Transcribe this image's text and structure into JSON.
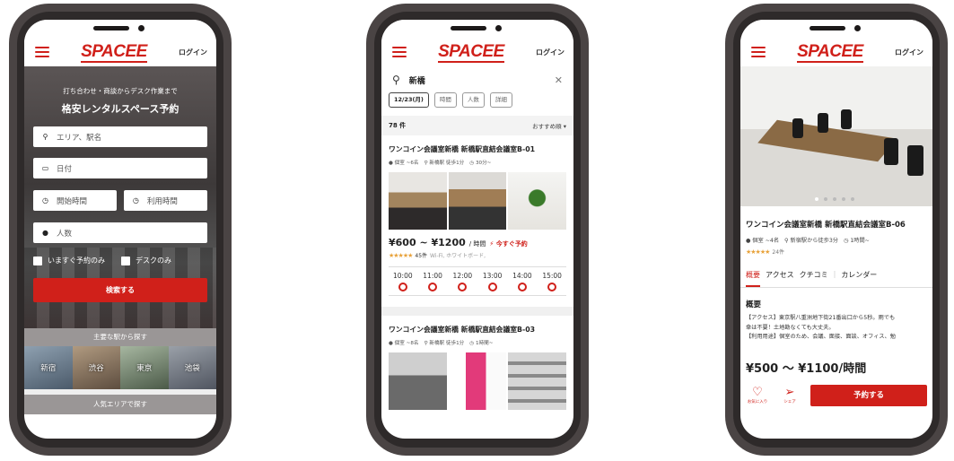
{
  "common": {
    "logo": "SPACEE",
    "login": "ログイン"
  },
  "colors": {
    "brand": "#d0201a",
    "frame": "#4a4444"
  },
  "phone1": {
    "tagline_1": "打ち合わせ・商談からデスク作業まで",
    "tagline_2": "格安レンタルスペース予約",
    "area_placeholder": "エリア、駅名",
    "date_placeholder": "日付",
    "start_placeholder": "開始時間",
    "duration_placeholder": "利用時間",
    "people_placeholder": "人数",
    "check_instant": "いますぐ予約のみ",
    "check_desk": "デスクのみ",
    "search_button": "検索する",
    "stations_title": "主要な駅から探す",
    "stations": [
      "新宿",
      "渋谷",
      "東京",
      "池袋"
    ],
    "areas_title": "人気エリアで探す"
  },
  "phone2": {
    "search_query": "新橋",
    "filters": [
      "12/23(月)",
      "時間",
      "人数",
      "詳細"
    ],
    "result_count": "78 件",
    "sort_label": "おすすめ順",
    "listings": [
      {
        "name": "ワンコイン会議室新橋 新橋駅直結会議室B-01",
        "capacity": "個室 ~6名",
        "access": "新橋駅 徒歩1分",
        "min_time": "30分~",
        "price": "¥600 ~ ¥1200",
        "price_unit": "/ 時間",
        "instant": "今すぐ予約",
        "rating_count": "45件",
        "amenities": "Wi-Fi, ホワイトボード,",
        "times": [
          "10:00",
          "11:00",
          "12:00",
          "13:00",
          "14:00",
          "15:00"
        ]
      },
      {
        "name": "ワンコイン会議室新橋 新橋駅直結会議室B-03",
        "capacity": "個室 ~8名",
        "access": "新橋駅 徒歩1分",
        "min_time": "1時間~"
      }
    ]
  },
  "phone3": {
    "name": "ワンコイン会議室新橋 新橋駅直結会議室B-06",
    "capacity": "個室 ~4名",
    "access": "新宿駅から徒歩3分",
    "min_time": "1時間~",
    "rating_count": "24件",
    "tabs": [
      "概要",
      "アクセス",
      "クチコミ",
      "|",
      "カレンダー"
    ],
    "overview_title": "概要",
    "overview_lines": [
      "【アクセス】東京駅八重洲地下街21番出口から5秒。雨でも",
      "傘は不要！土地勘なくても大丈夫。",
      "【利用用途】個室のため、会議、面接、面談、オフィス、勉"
    ],
    "price": "¥500 ～ ¥1100/時間",
    "favorite_label": "お気に入り",
    "share_label": "シェア",
    "book_button": "予約する"
  }
}
